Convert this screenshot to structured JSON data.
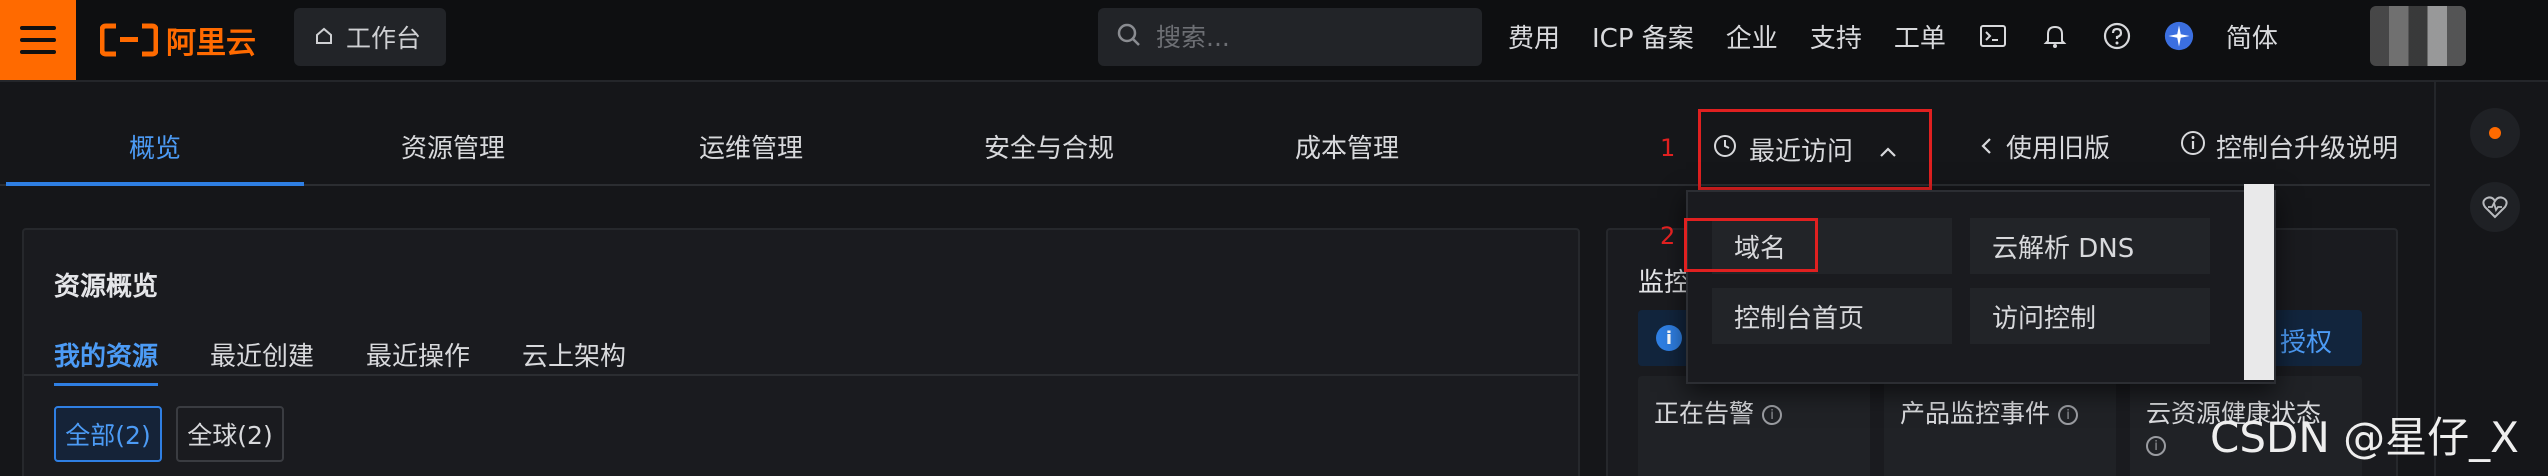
{
  "topbar": {
    "logo_text": "阿里云",
    "workbench": "工作台",
    "search_placeholder": "搜索...",
    "nav": [
      "费用",
      "ICP 备案",
      "企业",
      "支持",
      "工单"
    ],
    "language": "简体"
  },
  "tabs": [
    "概览",
    "资源管理",
    "运维管理",
    "安全与合规",
    "成本管理"
  ],
  "active_tab": "概览",
  "recent": {
    "label": "最近访问",
    "annotation": "1"
  },
  "legacy": "使用旧版",
  "upgrade": "控制台升级说明",
  "dropdown": {
    "annotation": "2",
    "items": [
      "域名",
      "云解析 DNS",
      "控制台首页",
      "访问控制"
    ]
  },
  "resource_panel": {
    "title": "资源概览",
    "subtabs": [
      "我的资源",
      "最近创建",
      "最近操作",
      "云上架构"
    ],
    "chips": [
      "全部(2)",
      "全球(2)"
    ]
  },
  "monitor_panel": {
    "title": "监控",
    "link": "授权",
    "cards": [
      "正在告警",
      "产品监控事件",
      "云资源健康状态"
    ]
  },
  "watermark": "CSDN @星仔_X",
  "colors": {
    "accent": "#2f7fe3",
    "brand": "#ff6a00",
    "annotation": "#e02020"
  }
}
